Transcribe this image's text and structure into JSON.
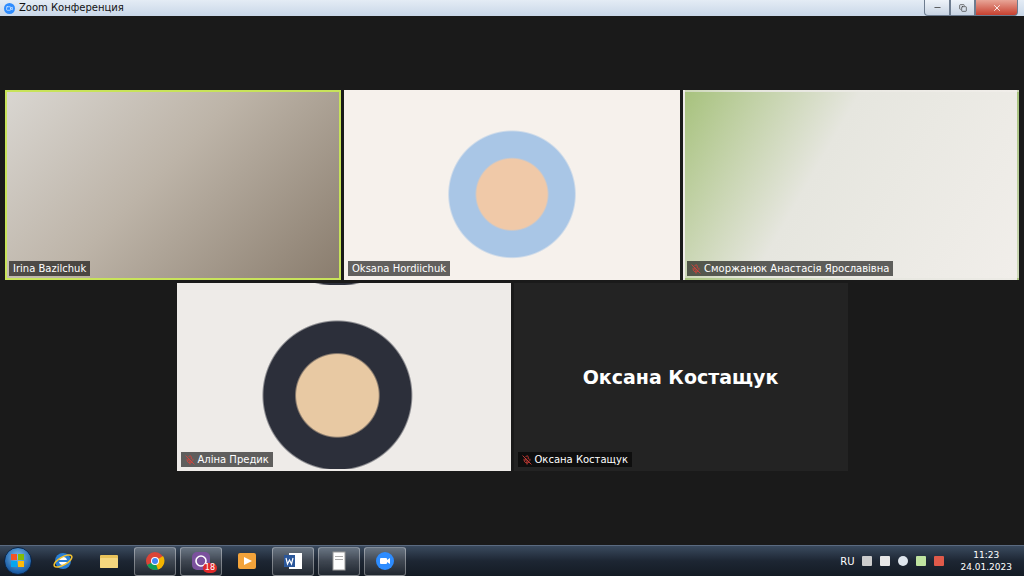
{
  "window": {
    "title": "Zoom Конференция"
  },
  "tiles_rows": [
    [
      {
        "name": "Irina Bazilchuk",
        "muted": false,
        "selected": true,
        "kind": "video"
      },
      {
        "name": "Oksana Hordiichuk",
        "muted": false,
        "selected": false,
        "kind": "video"
      },
      {
        "name": "Сморжанюк Анастасія Ярославівна",
        "muted": true,
        "selected": false,
        "kind": "video"
      }
    ],
    [
      {
        "name": "Аліна Предик",
        "muted": true,
        "selected": false,
        "kind": "video"
      },
      {
        "name": "Оксана Костащук",
        "muted": true,
        "selected": false,
        "kind": "avatar"
      }
    ]
  ],
  "taskbar": {
    "viber_badge": "18",
    "language": "RU",
    "time": "11:23",
    "date": "24.01.2023"
  }
}
